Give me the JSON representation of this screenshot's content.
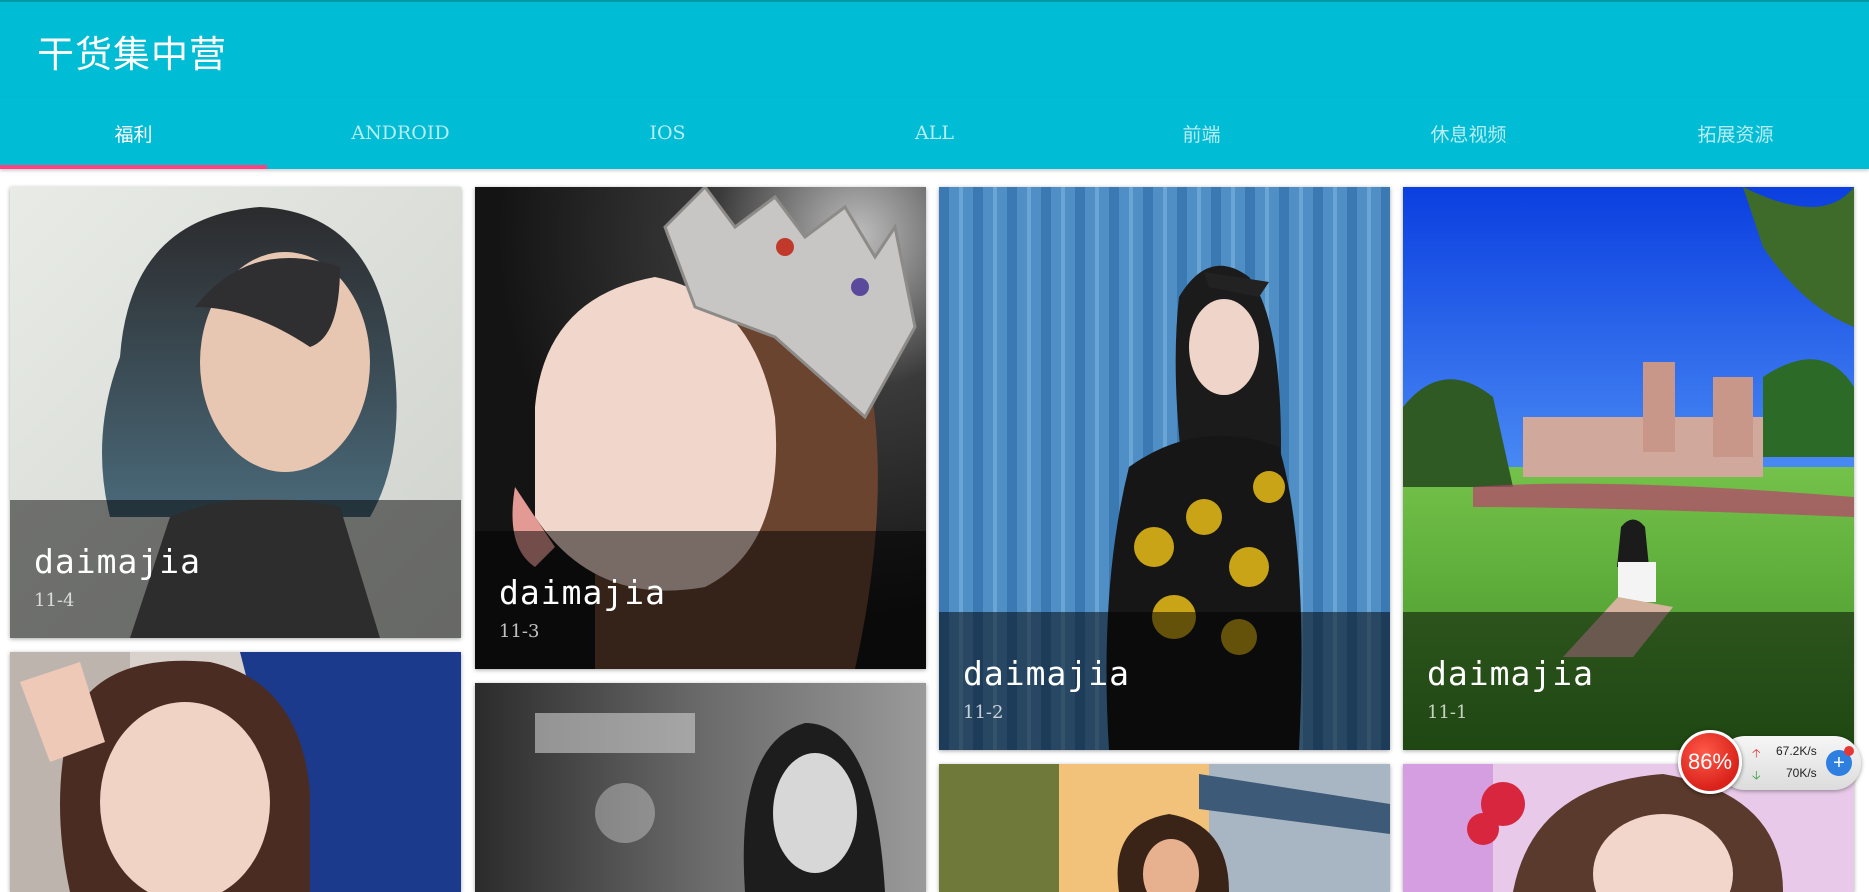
{
  "app": {
    "title": "干货集中营"
  },
  "tabs": [
    {
      "label": "福利",
      "active": true
    },
    {
      "label": "ANDROID",
      "active": false
    },
    {
      "label": "IOS",
      "active": false
    },
    {
      "label": "ALL",
      "active": false
    },
    {
      "label": "前端",
      "active": false
    },
    {
      "label": "休息视频",
      "active": false
    },
    {
      "label": "拓展资源",
      "active": false
    }
  ],
  "cards": [
    {
      "author": "daimajia",
      "date": "11-4"
    },
    {
      "author": "daimajia",
      "date": "11-3"
    },
    {
      "author": "daimajia",
      "date": "11-2"
    },
    {
      "author": "daimajia",
      "date": "11-1"
    }
  ],
  "widget": {
    "percent": "86%",
    "upload": "67.2K/s",
    "download": "70K/s"
  },
  "colors": {
    "primary": "#00bcd4",
    "accent": "#ff4081"
  }
}
